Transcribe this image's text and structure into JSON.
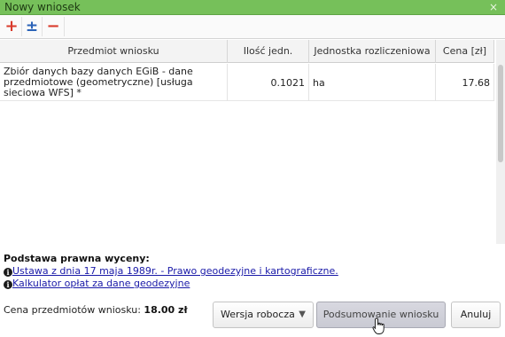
{
  "window": {
    "title": "Nowy wniosek",
    "close_glyph": "×"
  },
  "toolbar": {
    "add_glyph": "+",
    "plusminus_glyph": "±",
    "remove_glyph": "−"
  },
  "table": {
    "columns": [
      "Przedmiot wniosku",
      "Ilość jedn.",
      "Jednostka rozliczeniowa",
      "Cena [zł]"
    ],
    "rows": [
      {
        "item": "Zbiór danych bazy danych EGiB - dane przedmiotowe (geometryczne) [usługa sieciowa WFS] *",
        "quantity": "0.1021",
        "unit": "ha",
        "price": "17.68"
      }
    ]
  },
  "legal": {
    "heading": "Podstawa prawna wyceny:",
    "info_glyph": "i",
    "links": [
      "Ustawa z dnia 17 maja 1989r. - Prawo geodezyjne i kartograficzne.",
      "Kalkulator opłat za dane geodezyjne"
    ]
  },
  "summary": {
    "price_label": "Cena przedmiotów wniosku:",
    "price_value": "18.00 zł"
  },
  "buttons": {
    "draft_label": "Wersja robocza",
    "draft_caret": "▼",
    "summary_label": "Podsumowanie wniosku",
    "cancel_label": "Anuluj"
  },
  "colors": {
    "titlebar": "#76c05a",
    "add_icon": "#d93a2b",
    "plusminus_icon": "#2b63b8",
    "link": "#1a1aa8"
  }
}
